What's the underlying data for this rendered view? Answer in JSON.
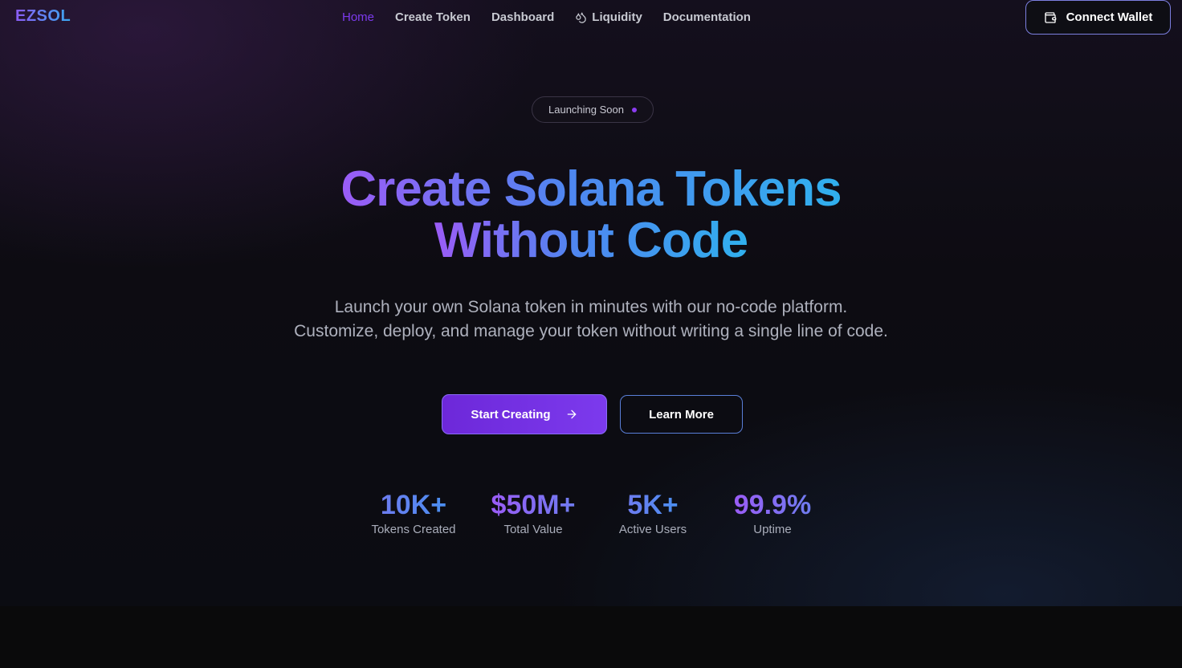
{
  "nav": {
    "logo": "EZSOL",
    "links": [
      {
        "label": "Home",
        "active": true
      },
      {
        "label": "Create Token",
        "active": false
      },
      {
        "label": "Dashboard",
        "active": false
      },
      {
        "label": "Liquidity",
        "active": false,
        "icon": "droplets-icon"
      },
      {
        "label": "Documentation",
        "active": false
      }
    ],
    "wallet_button": "Connect Wallet",
    "wallet_icon": "wallet-icon"
  },
  "hero": {
    "badge": "Launching Soon",
    "headline_line1": "Create Solana Tokens",
    "headline_line2": "Without Code",
    "subtitle": "Launch your own Solana token in minutes with our no-code platform. Customize, deploy, and manage your token without writing a single line of code.",
    "primary_button": "Start Creating",
    "primary_icon": "arrow-right-icon",
    "secondary_button": "Learn More"
  },
  "stats": [
    {
      "value": "10K+",
      "label": "Tokens Created"
    },
    {
      "value": "$50M+",
      "label": "Total Value"
    },
    {
      "value": "5K+",
      "label": "Active Users"
    },
    {
      "value": "99.9%",
      "label": "Uptime"
    }
  ],
  "colors": {
    "accent_purple": "#7c3aed",
    "accent_blue": "#30b0ee",
    "background": "#0a0a0d"
  }
}
